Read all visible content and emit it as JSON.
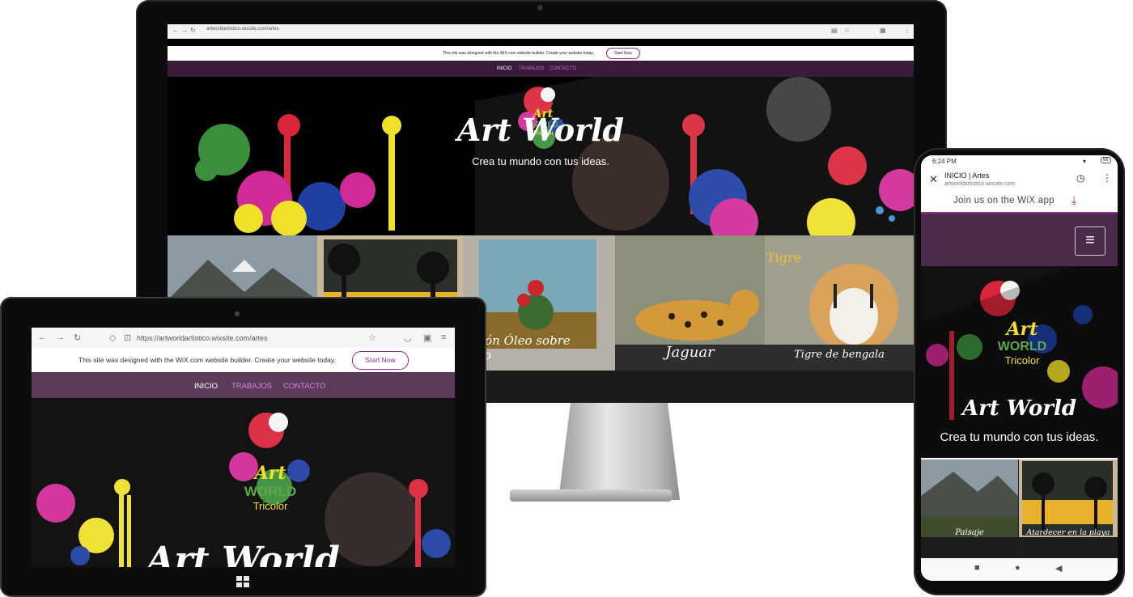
{
  "desktop": {
    "url": "artworldartistico.wixsite.com/artes",
    "banner_text": "This site was designed with the WiX.com website builder. Create your website today.",
    "banner_button": "Start Now",
    "nav": [
      "INICIO",
      "TRABAJOS",
      "CONTACTO"
    ],
    "site_title": "Art World",
    "tagline": "Crea tu mundo con tus ideas.",
    "gallery": [
      {
        "caption": ""
      },
      {
        "caption": ""
      },
      {
        "caption": "odegón Óleo sobre lienzo"
      },
      {
        "caption": "Jaguar"
      },
      {
        "caption": "Tigre de bengala"
      }
    ],
    "tiger_sign": "Tigre"
  },
  "tablet": {
    "url": "https://artworldartistico.wixsite.com/artes",
    "banner_text": "This site was designed with the WiX.com website builder. Create your website today.",
    "banner_button": "Start Now",
    "nav": [
      "INICIO",
      "TRABAJOS",
      "CONTACTO"
    ],
    "site_title": "Art World"
  },
  "phone": {
    "status_time": "6:24 PM",
    "status_battery": "66",
    "page_title": "INICIO | Artes",
    "url": "artworldartistico.wixsite.com",
    "join_text": "Join us on the WiX app",
    "site_title": "Art World",
    "tagline": "Crea tu mundo con tus ideas.",
    "gallery": [
      {
        "caption": "Paisaje"
      },
      {
        "caption": "Atardecer en la playa"
      }
    ]
  },
  "logo": {
    "art": "Art",
    "world": "WORLD",
    "tricolor": "Tricolor"
  },
  "colors": {
    "accent": "#8e2a8e",
    "nav_dark": "#3a1c3a",
    "nav_tablet": "#5a3c5a",
    "header_phone": "#4a2c4a"
  }
}
